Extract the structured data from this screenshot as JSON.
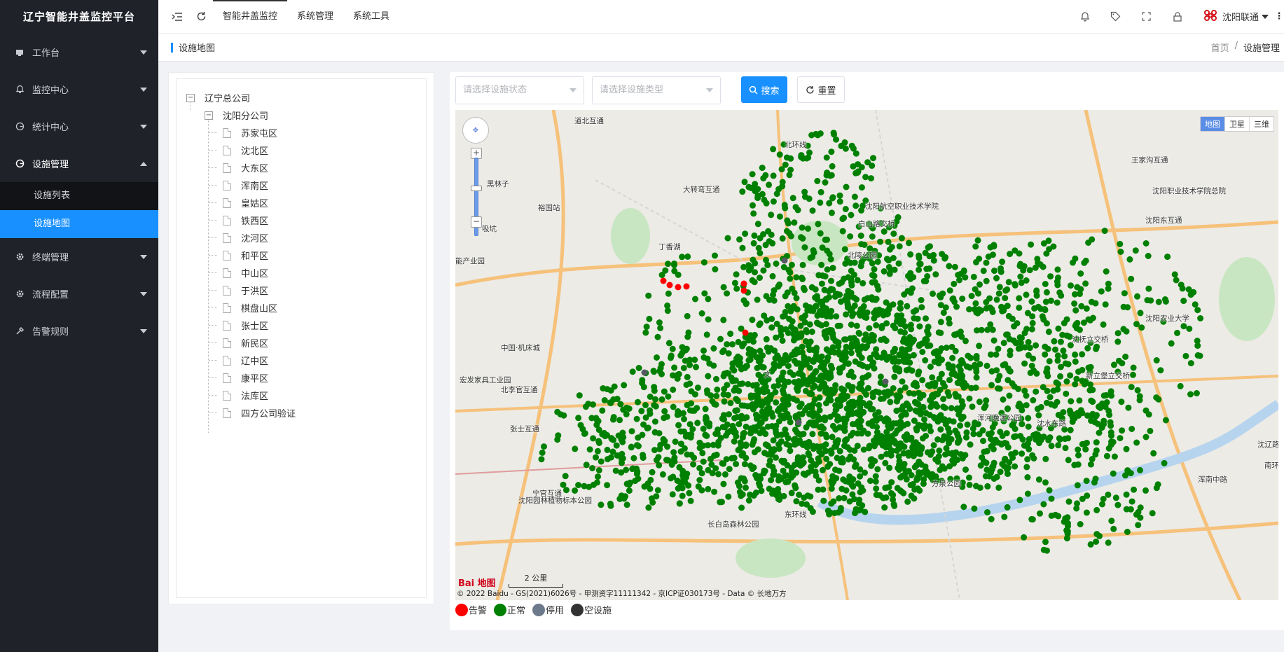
{
  "app": {
    "title": "辽宁智能井盖监控平台"
  },
  "sidebar": {
    "items": [
      {
        "label": "工作台",
        "icon": "monitor-icon",
        "expanded": false
      },
      {
        "label": "监控中心",
        "icon": "bell-icon",
        "expanded": false
      },
      {
        "label": "统计中心",
        "icon": "chart-icon",
        "expanded": false
      },
      {
        "label": "设施管理",
        "icon": "facility-icon",
        "expanded": true,
        "children": [
          {
            "label": "设施列表",
            "active": false
          },
          {
            "label": "设施地图",
            "active": true
          }
        ]
      },
      {
        "label": "终端管理",
        "icon": "gear-icon",
        "expanded": false
      },
      {
        "label": "流程配置",
        "icon": "gear-icon",
        "expanded": false
      },
      {
        "label": "告警规则",
        "icon": "tools-icon",
        "expanded": false
      }
    ]
  },
  "topbar": {
    "tabs": [
      {
        "label": "智能井盖监控",
        "active": true
      },
      {
        "label": "系统管理",
        "active": false
      },
      {
        "label": "系统工具",
        "active": false
      }
    ],
    "user": "沈阳联通"
  },
  "page": {
    "title": "设施地图",
    "breadcrumb": [
      "首页",
      "设施管理"
    ]
  },
  "tree": {
    "root": "辽宁总公司",
    "branch": "沈阳分公司",
    "leaves": [
      "苏家屯区",
      "沈北区",
      "大东区",
      "浑南区",
      "皇姑区",
      "铁西区",
      "沈河区",
      "和平区",
      "中山区",
      "于洪区",
      "棋盘山区",
      "张士区",
      "新民区",
      "辽中区",
      "康平区",
      "法库区",
      "四方公司验证"
    ]
  },
  "filters": {
    "status_placeholder": "请选择设施状态",
    "type_placeholder": "请选择设施类型",
    "search_label": "搜索",
    "reset_label": "重置"
  },
  "map": {
    "types": [
      {
        "label": "地图",
        "active": true
      },
      {
        "label": "卫星",
        "active": false
      },
      {
        "label": "三维",
        "active": false
      }
    ],
    "labels": [
      "道北互通",
      "北环线",
      "黑林子",
      "大转弯互通",
      "裕国站",
      "沈阳职业技术学院总院",
      "王家沟互通",
      "沈阳东互通",
      "吸坑",
      "沈阳航空职业技术学院",
      "白山路交桥",
      "丁香湖",
      "北陵公园",
      "能产业园",
      "文",
      "中国·机床城",
      "宏发家具工业园",
      "北李官互通",
      "张士互通",
      "宁官互通",
      "沈阳农业大学",
      "沈抚立交桥",
      "新立堡立交桥",
      "沈水东路",
      "浑南中路",
      "东环线",
      "长白岛森林公园",
      "浑河晚渡公园",
      "方泉公园",
      "沈阳园林植物标本公园",
      "沈辽路",
      "南环线"
    ],
    "scale": "2 公里",
    "logo": "Bai 地图",
    "copyright": "© 2022 Baidu - GS(2021)6026号 - 甲测资字11111342 - 京ICP证030173号 - Data © 长地万方"
  },
  "legend": [
    {
      "label": "告警",
      "color": "#ff0000"
    },
    {
      "label": "正常",
      "color": "#008000"
    },
    {
      "label": "停用",
      "color": "#6c7a8c"
    },
    {
      "label": "空设施",
      "color": "#333333"
    }
  ],
  "colors": {
    "accent": "#1890ff",
    "sidebar_bg": "#1f2229",
    "normal": "#008000",
    "alarm": "#ff0000"
  }
}
